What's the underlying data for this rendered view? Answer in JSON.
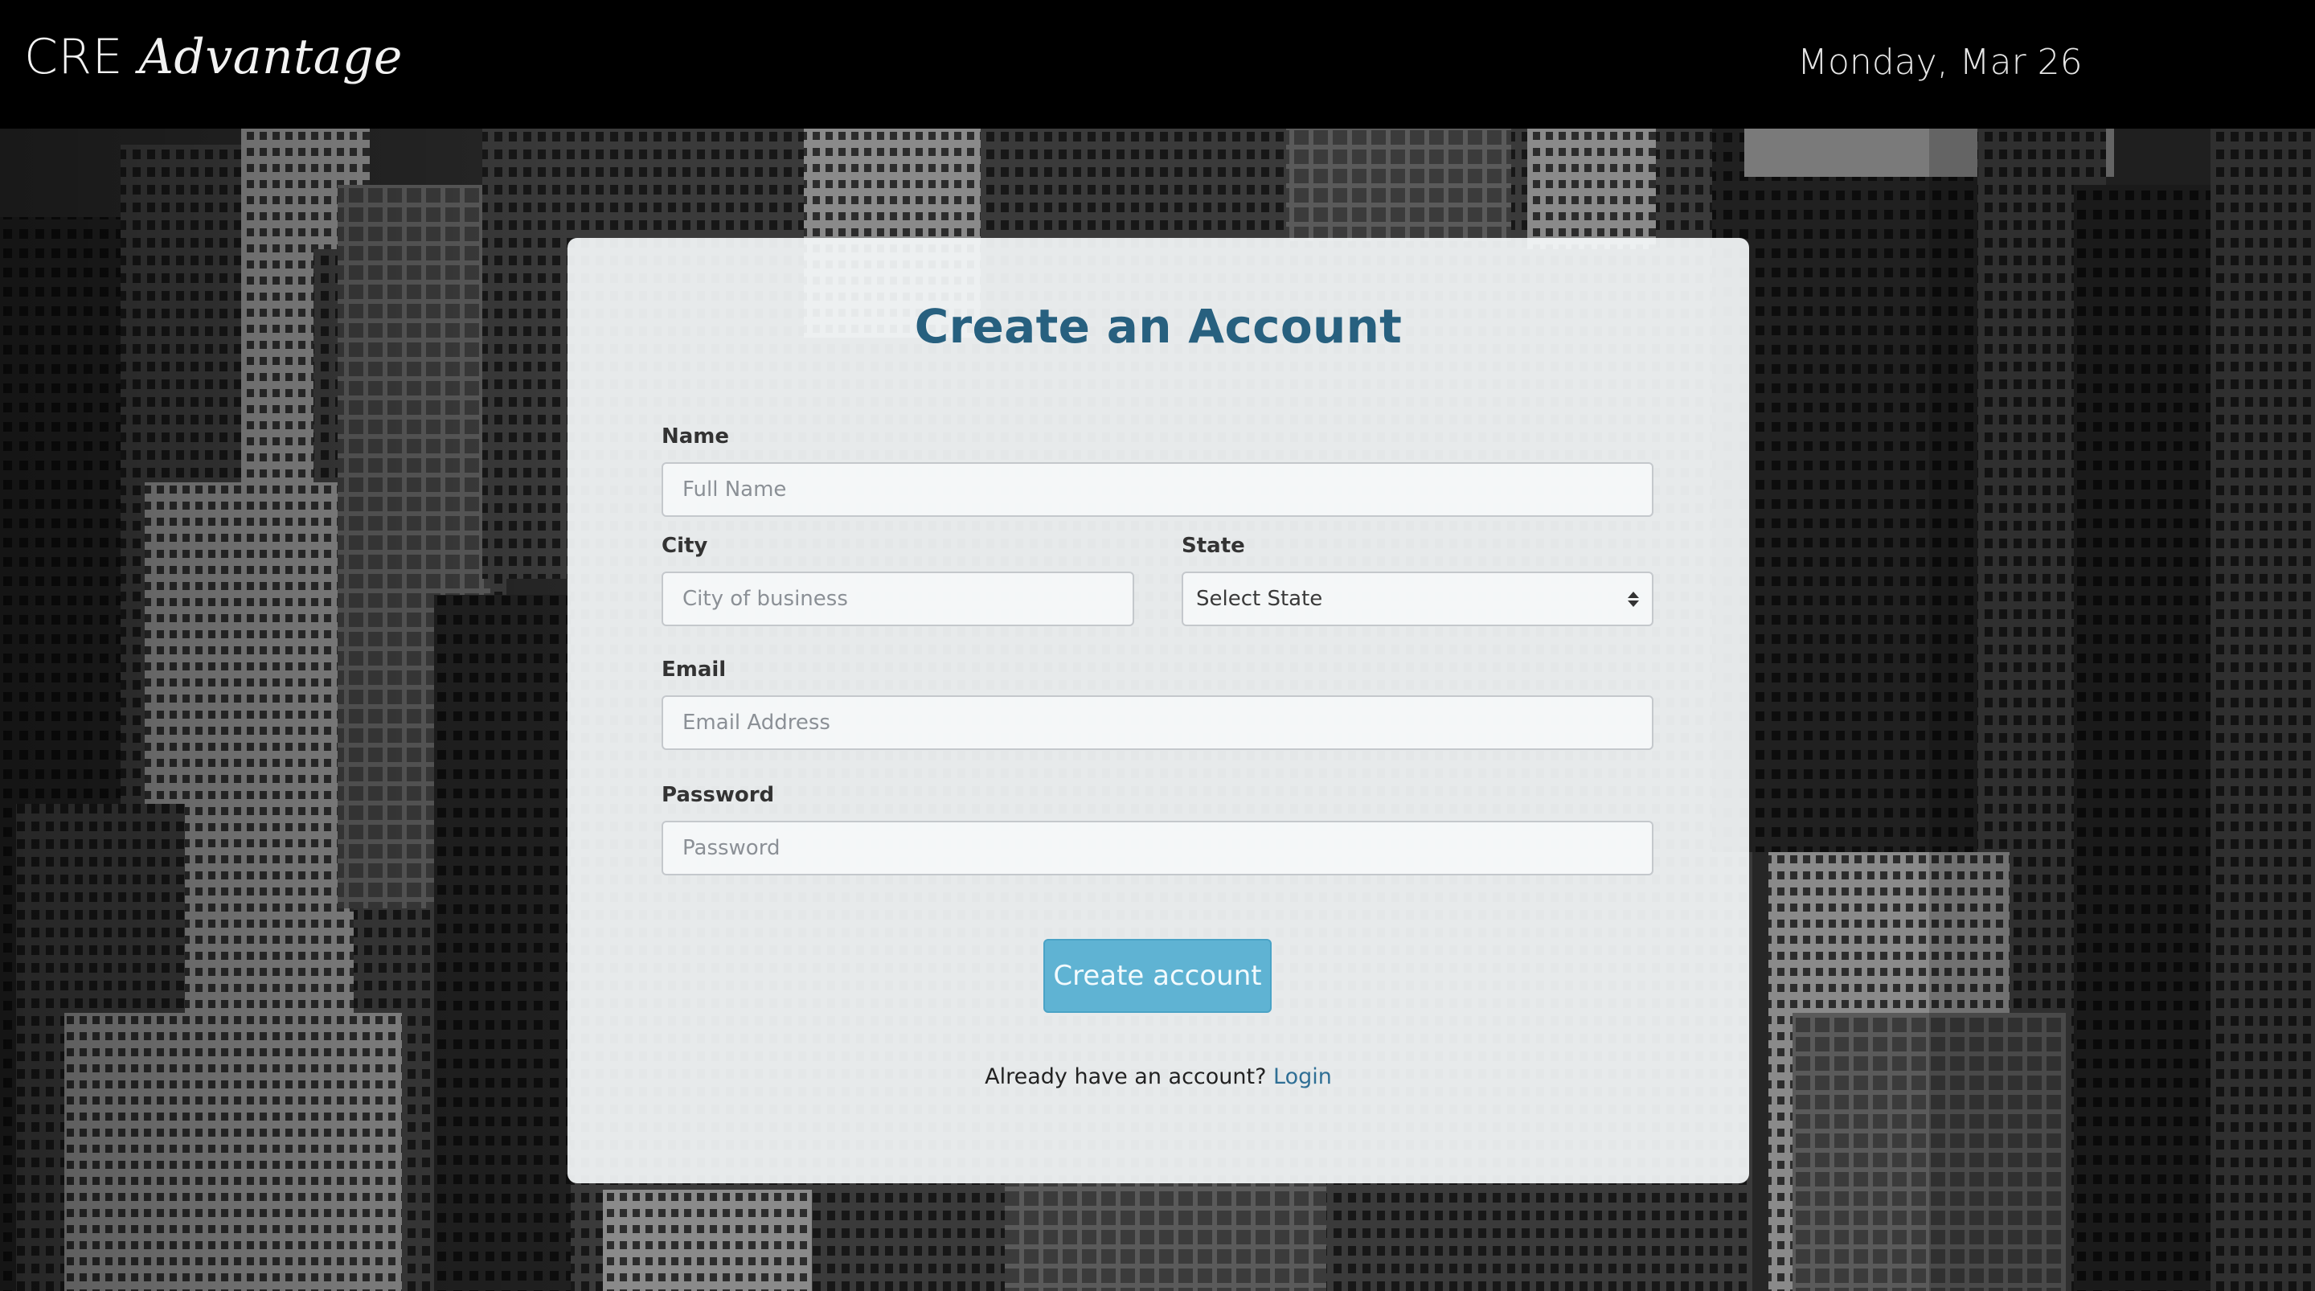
{
  "header": {
    "brand_prefix": "CRE",
    "brand_suffix": "Advantage",
    "date": "Monday, Mar 26"
  },
  "form": {
    "title": "Create an Account",
    "name_label": "Name",
    "name_placeholder": "Full Name",
    "city_label": "City",
    "city_placeholder": "City of business",
    "state_label": "State",
    "state_selected": "Select State",
    "email_label": "Email",
    "email_placeholder": "Email Address",
    "password_label": "Password",
    "password_placeholder": "Password",
    "submit_label": "Create account",
    "login_prompt": "Already have an account?",
    "login_link": "Login"
  },
  "colors": {
    "title": "#27607f",
    "button": "#5fb3d3",
    "link": "#2f6f95",
    "topbar": "#000000"
  },
  "icons": {
    "state_select": "select-updown-arrows-icon"
  }
}
